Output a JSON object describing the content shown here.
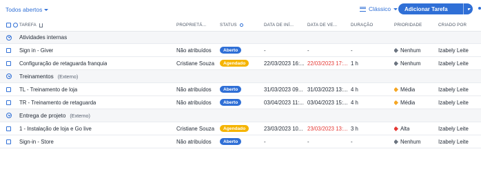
{
  "toolbar": {
    "view_label": "Todos abertos",
    "mode_label": "Clássico",
    "add_button_label": "Adicionar Tarefa"
  },
  "columns": [
    "TAREFA",
    "PROPRIETÁ...",
    "STATUS",
    "DATA DE INÍ...",
    "DATA DE VE...",
    "DURAÇÃO",
    "PRIORIDADE",
    "CRIADO POR"
  ],
  "colors": {
    "accent": "#2f6fd6",
    "aberto": "#2f6fd6",
    "agendado": "#f5b400",
    "nenhum": "#6b7480",
    "media": "#f5a623",
    "alta": "#e53935",
    "overdue": "#e53935"
  },
  "groups": [
    {
      "title": "Atividades internas",
      "subtitle": "",
      "rows": [
        {
          "task": "Sign in - Giver",
          "owner": "Não atribuídos",
          "status": "Aberto",
          "status_kind": "aberto",
          "start": "-",
          "due": "-",
          "due_overdue": false,
          "duration": "-",
          "priority": "Nenhum",
          "priority_kind": "nenhum",
          "creator": "Izabely Leite"
        },
        {
          "task": "Configuração de retaguarda franquia",
          "owner": "Cristiane Souza",
          "status": "Agendado",
          "status_kind": "agendado",
          "start": "22/03/2023 16:...",
          "due": "22/03/2023 17:...",
          "due_overdue": true,
          "duration": "1 h",
          "priority": "Nenhum",
          "priority_kind": "nenhum",
          "creator": "Izabely Leite"
        }
      ]
    },
    {
      "title": "Treinamentos",
      "subtitle": "(Externo)",
      "rows": [
        {
          "task": "TL - Treinamento de loja",
          "owner": "Não atribuídos",
          "status": "Aberto",
          "status_kind": "aberto",
          "start": "31/03/2023 09...",
          "due": "31/03/2023 13:...",
          "due_overdue": false,
          "duration": "4 h",
          "priority": "Média",
          "priority_kind": "media",
          "creator": "Izabely Leite"
        },
        {
          "task": "TR - Treinamento de retaguarda",
          "owner": "Não atribuídos",
          "status": "Aberto",
          "status_kind": "aberto",
          "start": "03/04/2023 11:...",
          "due": "03/04/2023 15:...",
          "due_overdue": false,
          "duration": "4 h",
          "priority": "Média",
          "priority_kind": "media",
          "creator": "Izabely Leite"
        }
      ]
    },
    {
      "title": "Entrega de projeto",
      "subtitle": "(Externo)",
      "rows": [
        {
          "task": "1 - Instalação de loja e Go live",
          "owner": "Cristiane Souza",
          "status": "Agendado",
          "status_kind": "agendado",
          "start": "23/03/2023 10...",
          "due": "23/03/2023 13:...",
          "due_overdue": true,
          "duration": "3 h",
          "priority": "Alta",
          "priority_kind": "alta",
          "creator": "Izabely Leite"
        },
        {
          "task": "Sign-in - Store",
          "owner": "Não atribuídos",
          "status": "Aberto",
          "status_kind": "aberto",
          "start": "-",
          "due": "-",
          "due_overdue": false,
          "duration": "-",
          "priority": "Nenhum",
          "priority_kind": "nenhum",
          "creator": "Izabely Leite"
        }
      ]
    }
  ]
}
